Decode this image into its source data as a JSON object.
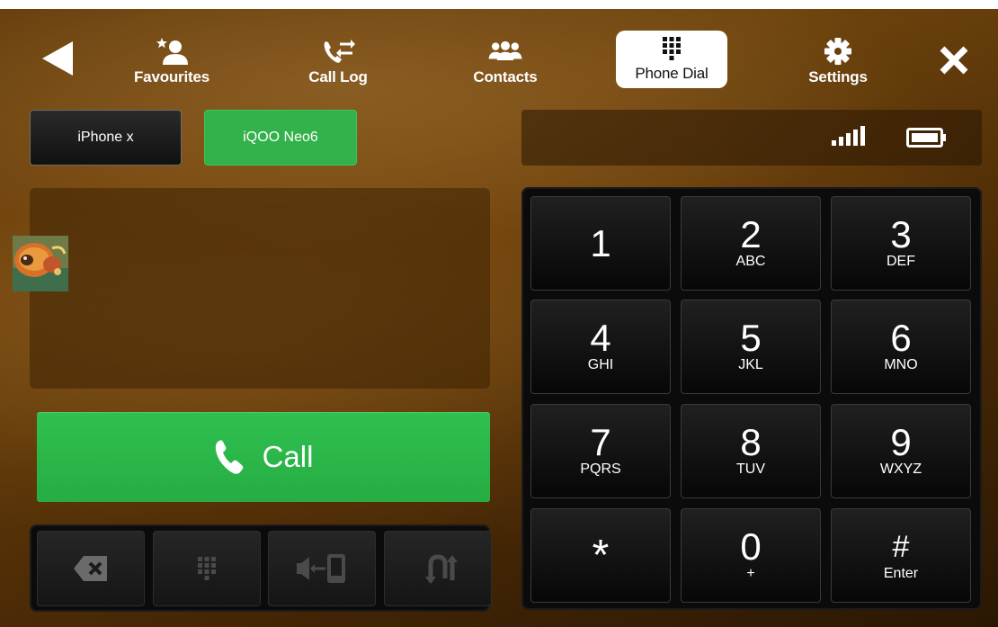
{
  "header": {
    "nav": [
      {
        "key": "favourites",
        "label": "Favourites",
        "icon": "favourites-icon",
        "active": false
      },
      {
        "key": "call-log",
        "label": "Call Log",
        "icon": "call-log-icon",
        "active": false
      },
      {
        "key": "contacts",
        "label": "Contacts",
        "icon": "contacts-icon",
        "active": false
      },
      {
        "key": "phone-dial",
        "label": "Phone Dial",
        "icon": "dialpad-icon",
        "active": true
      },
      {
        "key": "settings",
        "label": "Settings",
        "icon": "gear-icon",
        "active": false
      }
    ],
    "back_icon": "back-arrow-icon",
    "close_icon": "close-icon"
  },
  "devices": [
    {
      "label": "iPhone x",
      "selected": false
    },
    {
      "label": "iQOO Neo6",
      "selected": true
    }
  ],
  "status": {
    "signal_icon": "signal-strength-icon",
    "battery_icon": "battery-icon"
  },
  "dial_display": {
    "number": "",
    "avatar_icon": "contact-avatar"
  },
  "call_button": {
    "label": "Call",
    "icon": "phone-icon"
  },
  "toolbar": [
    {
      "name": "backspace",
      "icon": "backspace-icon"
    },
    {
      "name": "keypad",
      "icon": "dialpad-icon"
    },
    {
      "name": "audio-transfer",
      "icon": "audio-transfer-icon"
    },
    {
      "name": "switch-call",
      "icon": "switch-call-icon"
    }
  ],
  "keypad": {
    "keys": [
      {
        "digit": "1",
        "letters": ""
      },
      {
        "digit": "2",
        "letters": "ABC"
      },
      {
        "digit": "3",
        "letters": "DEF"
      },
      {
        "digit": "4",
        "letters": "GHI"
      },
      {
        "digit": "5",
        "letters": "JKL"
      },
      {
        "digit": "6",
        "letters": "MNO"
      },
      {
        "digit": "7",
        "letters": "PQRS"
      },
      {
        "digit": "8",
        "letters": "TUV"
      },
      {
        "digit": "9",
        "letters": "WXYZ"
      },
      {
        "digit": "*",
        "letters": ""
      },
      {
        "digit": "0",
        "letters": "+"
      },
      {
        "digit": "#",
        "letters": "Enter"
      }
    ]
  },
  "colors": {
    "accent_green": "#33b14a",
    "active_tab_bg": "#ffffff",
    "keypad_bg": "#0b0b0b"
  }
}
